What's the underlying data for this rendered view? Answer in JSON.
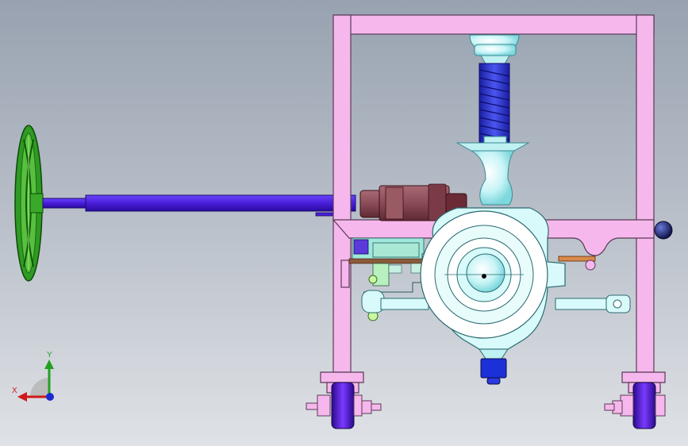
{
  "viewport": {
    "background_top": "#98a2b0",
    "background_bottom": "#dfe2e6"
  },
  "triad": {
    "x_label": "X",
    "y_label": "Y",
    "x_color": "#d01818",
    "y_color": "#22a022",
    "z_color": "#1c2ad0"
  },
  "model": {
    "frame_color": "#f6b8ec",
    "handwheel_color": "#2f9a24",
    "shaft_color": "#4a1ed8",
    "housing_color": "#d8fafa",
    "spring_color": "#2a2ecc",
    "gearbox_color": "#8a4a56",
    "wheel_color": "#5a10d0",
    "knob_color": "#1a2a8a"
  }
}
